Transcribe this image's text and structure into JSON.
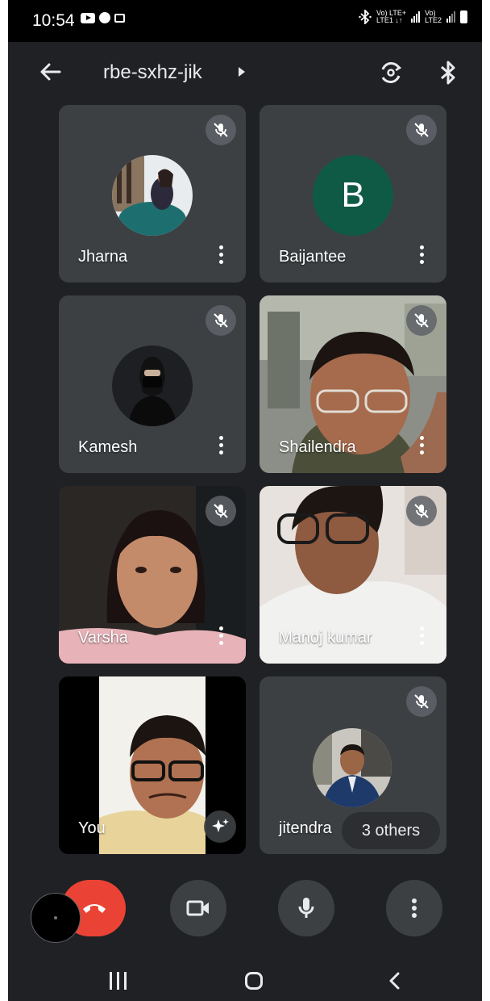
{
  "status_bar": {
    "time": "10:54",
    "network_line1": "Vo) LTE+",
    "network_line2": "LTE1 ↓↑",
    "network2_line1": "Vo)",
    "network2_line2": "LTE2"
  },
  "header": {
    "meeting_code": "rbe-sxhz-jik"
  },
  "participants": [
    {
      "name": "Jharna",
      "tile_type": "photo-avatar",
      "muted": true
    },
    {
      "name": "Baijantee",
      "tile_type": "letter-avatar",
      "avatar_letter": "B",
      "avatar_color": "#0f5a44",
      "muted": true
    },
    {
      "name": "Kamesh",
      "tile_type": "photo-avatar",
      "muted": true
    },
    {
      "name": "Shailendra",
      "tile_type": "video",
      "muted": true
    },
    {
      "name": "Varsha",
      "tile_type": "video",
      "muted": true
    },
    {
      "name": "Manoj kumar",
      "tile_type": "video",
      "muted": true
    },
    {
      "name": "You",
      "tile_type": "video",
      "muted": false
    },
    {
      "name": "jitendra",
      "tile_type": "photo-avatar",
      "muted": true
    }
  ],
  "others_pill": "3 others",
  "colors": {
    "background": "#202124",
    "tile": "#3c4043",
    "end_call": "#ea4335"
  }
}
